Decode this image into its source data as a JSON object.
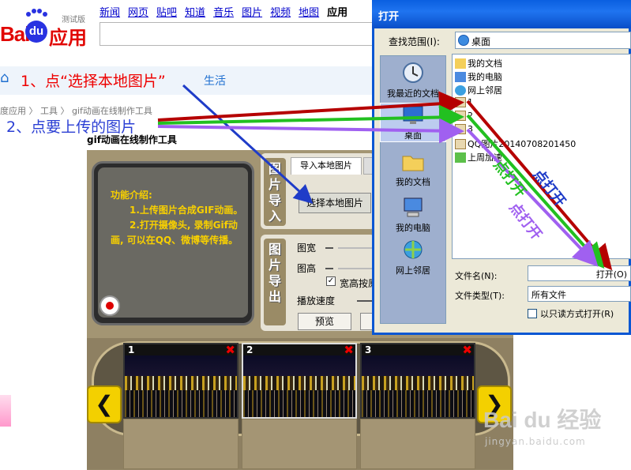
{
  "header": {
    "logo_text_bai": "Bai",
    "logo_text_du": "du",
    "logo_text_app": "应用",
    "logo_badge": "测试版",
    "nav": [
      "新闻",
      "网页",
      "贴吧",
      "知道",
      "音乐",
      "图片",
      "视频",
      "地图",
      "应用"
    ],
    "search_value": ""
  },
  "subbar": {
    "step1": "1、点“选择本地图片”",
    "trailing_link": "生活"
  },
  "breadcrumb": "度应用 〉 工具 〉 gif动画在线制作工具",
  "step2": "2、点要上传的图片",
  "tool": {
    "title": "gif动画在线制作工具",
    "feature_text": "功能介绍:\n　　1.上传图片合成GIF动画。\n　　2.打开摄像头, 录制Gif动画, 可以在QQ、微博等传播。",
    "section_import": "图片导入",
    "section_export": "图片导出",
    "tab_import": "导入本地图片",
    "choose_button": "选择本地图片",
    "width_label": "图宽",
    "height_label": "图高",
    "keep_ratio_label": "宽高按原",
    "speed_label": "播放速度",
    "preview_button": "预览",
    "frames": [
      {
        "number": "1"
      },
      {
        "number": "2"
      },
      {
        "number": "3"
      }
    ],
    "prev_arrow": "❮",
    "next_arrow": "❯"
  },
  "dialog": {
    "title": "打开",
    "look_in_label": "查找范围(I):",
    "look_in_value": "桌面",
    "places": [
      "我最近的文档",
      "桌面",
      "我的文档",
      "我的电脑",
      "网上邻居"
    ],
    "files": [
      "我的文档",
      "我的电脑",
      "网上邻居",
      "1",
      "2",
      "3",
      "QQ图片20140708201450",
      "上周加速"
    ],
    "filename_label": "文件名(N):",
    "filename_value": "打开(O)",
    "filetype_label": "文件类型(T):",
    "filetype_value": "所有文件",
    "readonly_label": "以只读方式打开(R)"
  },
  "annotations": {
    "dakai": "点打开"
  },
  "watermark": {
    "brand": "Bai du 经验",
    "url": "jingyan.baidu.com"
  },
  "colors": {
    "red_arrow": "#b50000",
    "green_arrow": "#22c020",
    "purple_arrow": "#a060f0",
    "blue_arrow": "#1f3cc8",
    "dialog_title": "#0a5fe0"
  }
}
